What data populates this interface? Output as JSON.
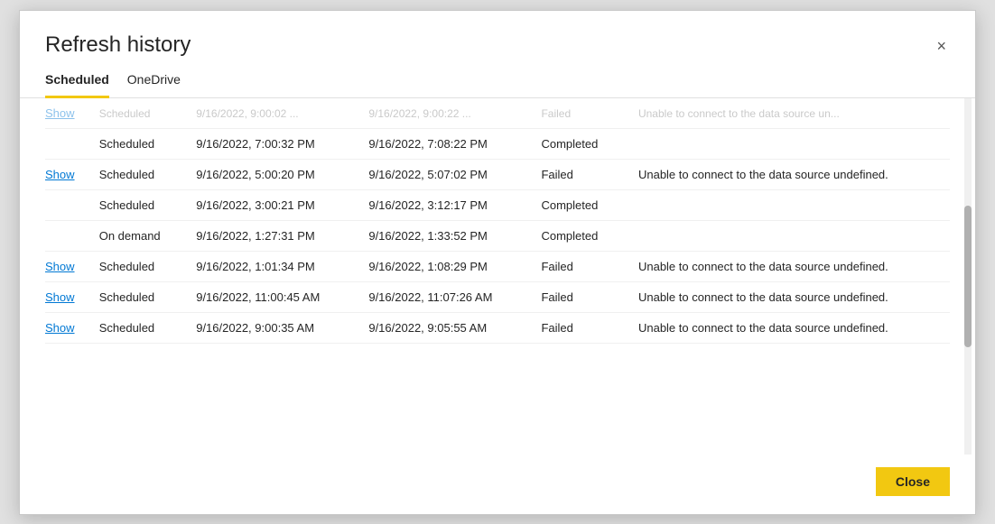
{
  "modal": {
    "title": "Refresh history",
    "close_icon": "×"
  },
  "tabs": [
    {
      "id": "scheduled",
      "label": "Scheduled",
      "active": true
    },
    {
      "id": "onedrive",
      "label": "OneDrive",
      "active": false
    }
  ],
  "table": {
    "rows": [
      {
        "show_link": "Show",
        "type": "Scheduled",
        "start": "9/16/2022, 9:00:02 ...",
        "end": "9/16/2022, 9:00:22 ...",
        "status": "Failed",
        "error": "Unable to connect to the data source un...",
        "partial": true
      },
      {
        "show_link": "",
        "type": "Scheduled",
        "start": "9/16/2022, 7:00:32 PM",
        "end": "9/16/2022, 7:08:22 PM",
        "status": "Completed",
        "error": "",
        "partial": false
      },
      {
        "show_link": "Show",
        "type": "Scheduled",
        "start": "9/16/2022, 5:00:20 PM",
        "end": "9/16/2022, 5:07:02 PM",
        "status": "Failed",
        "error": "Unable to connect to the data source undefined.",
        "partial": false
      },
      {
        "show_link": "",
        "type": "Scheduled",
        "start": "9/16/2022, 3:00:21 PM",
        "end": "9/16/2022, 3:12:17 PM",
        "status": "Completed",
        "error": "",
        "partial": false
      },
      {
        "show_link": "",
        "type": "On demand",
        "start": "9/16/2022, 1:27:31 PM",
        "end": "9/16/2022, 1:33:52 PM",
        "status": "Completed",
        "error": "",
        "partial": false
      },
      {
        "show_link": "Show",
        "type": "Scheduled",
        "start": "9/16/2022, 1:01:34 PM",
        "end": "9/16/2022, 1:08:29 PM",
        "status": "Failed",
        "error": "Unable to connect to the data source undefined.",
        "partial": false
      },
      {
        "show_link": "Show",
        "type": "Scheduled",
        "start": "9/16/2022, 11:00:45 AM",
        "end": "9/16/2022, 11:07:26 AM",
        "status": "Failed",
        "error": "Unable to connect to the data source undefined.",
        "partial": false
      },
      {
        "show_link": "Show",
        "type": "Scheduled",
        "start": "9/16/2022, 9:00:35 AM",
        "end": "9/16/2022, 9:05:55 AM",
        "status": "Failed",
        "error": "Unable to connect to the data source undefined.",
        "partial": false
      }
    ]
  },
  "footer": {
    "close_label": "Close"
  }
}
